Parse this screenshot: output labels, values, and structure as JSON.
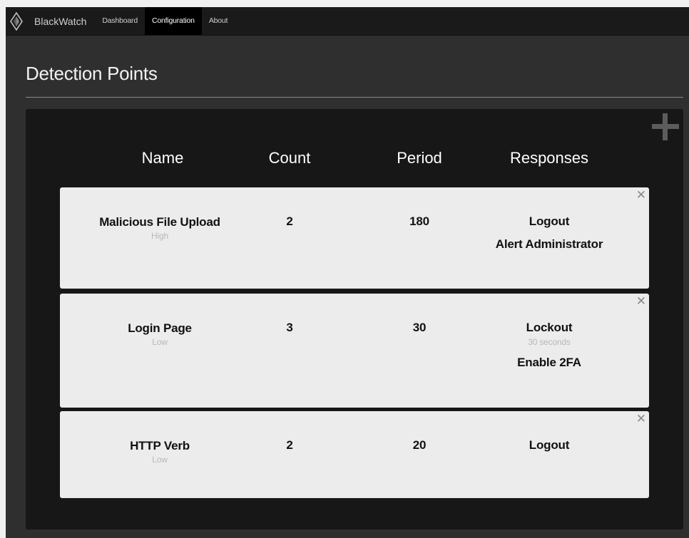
{
  "nav": {
    "brand": "BlackWatch",
    "links": [
      "Dashboard",
      "Configuration",
      "About"
    ]
  },
  "page": {
    "title": "Detection Points"
  },
  "table": {
    "headers": [
      "Name",
      "Count",
      "Period",
      "Responses"
    ],
    "rows": [
      {
        "name": "Malicious File Upload",
        "severity": "High",
        "count": "2",
        "period": "180",
        "responses": [
          {
            "label": "Logout",
            "detail": ""
          },
          {
            "label": "Alert Administrator",
            "detail": ""
          }
        ]
      },
      {
        "name": "Login Page",
        "severity": "Low",
        "count": "3",
        "period": "30",
        "responses": [
          {
            "label": "Lockout",
            "detail": "30 seconds"
          },
          {
            "label": "Enable 2FA",
            "detail": ""
          }
        ]
      },
      {
        "name": "HTTP Verb",
        "severity": "Low",
        "count": "2",
        "period": "20",
        "responses": [
          {
            "label": "Logout",
            "detail": ""
          }
        ]
      }
    ]
  },
  "icons": {
    "close": "close-icon",
    "add": "plus-icon",
    "logo": "diamond-logo-icon"
  },
  "colors": {
    "navbar": "#1a1a1a",
    "background": "#2f2f2f",
    "panel": "#171717",
    "card": "#ececec",
    "muted_text": "#b8b8b8"
  }
}
